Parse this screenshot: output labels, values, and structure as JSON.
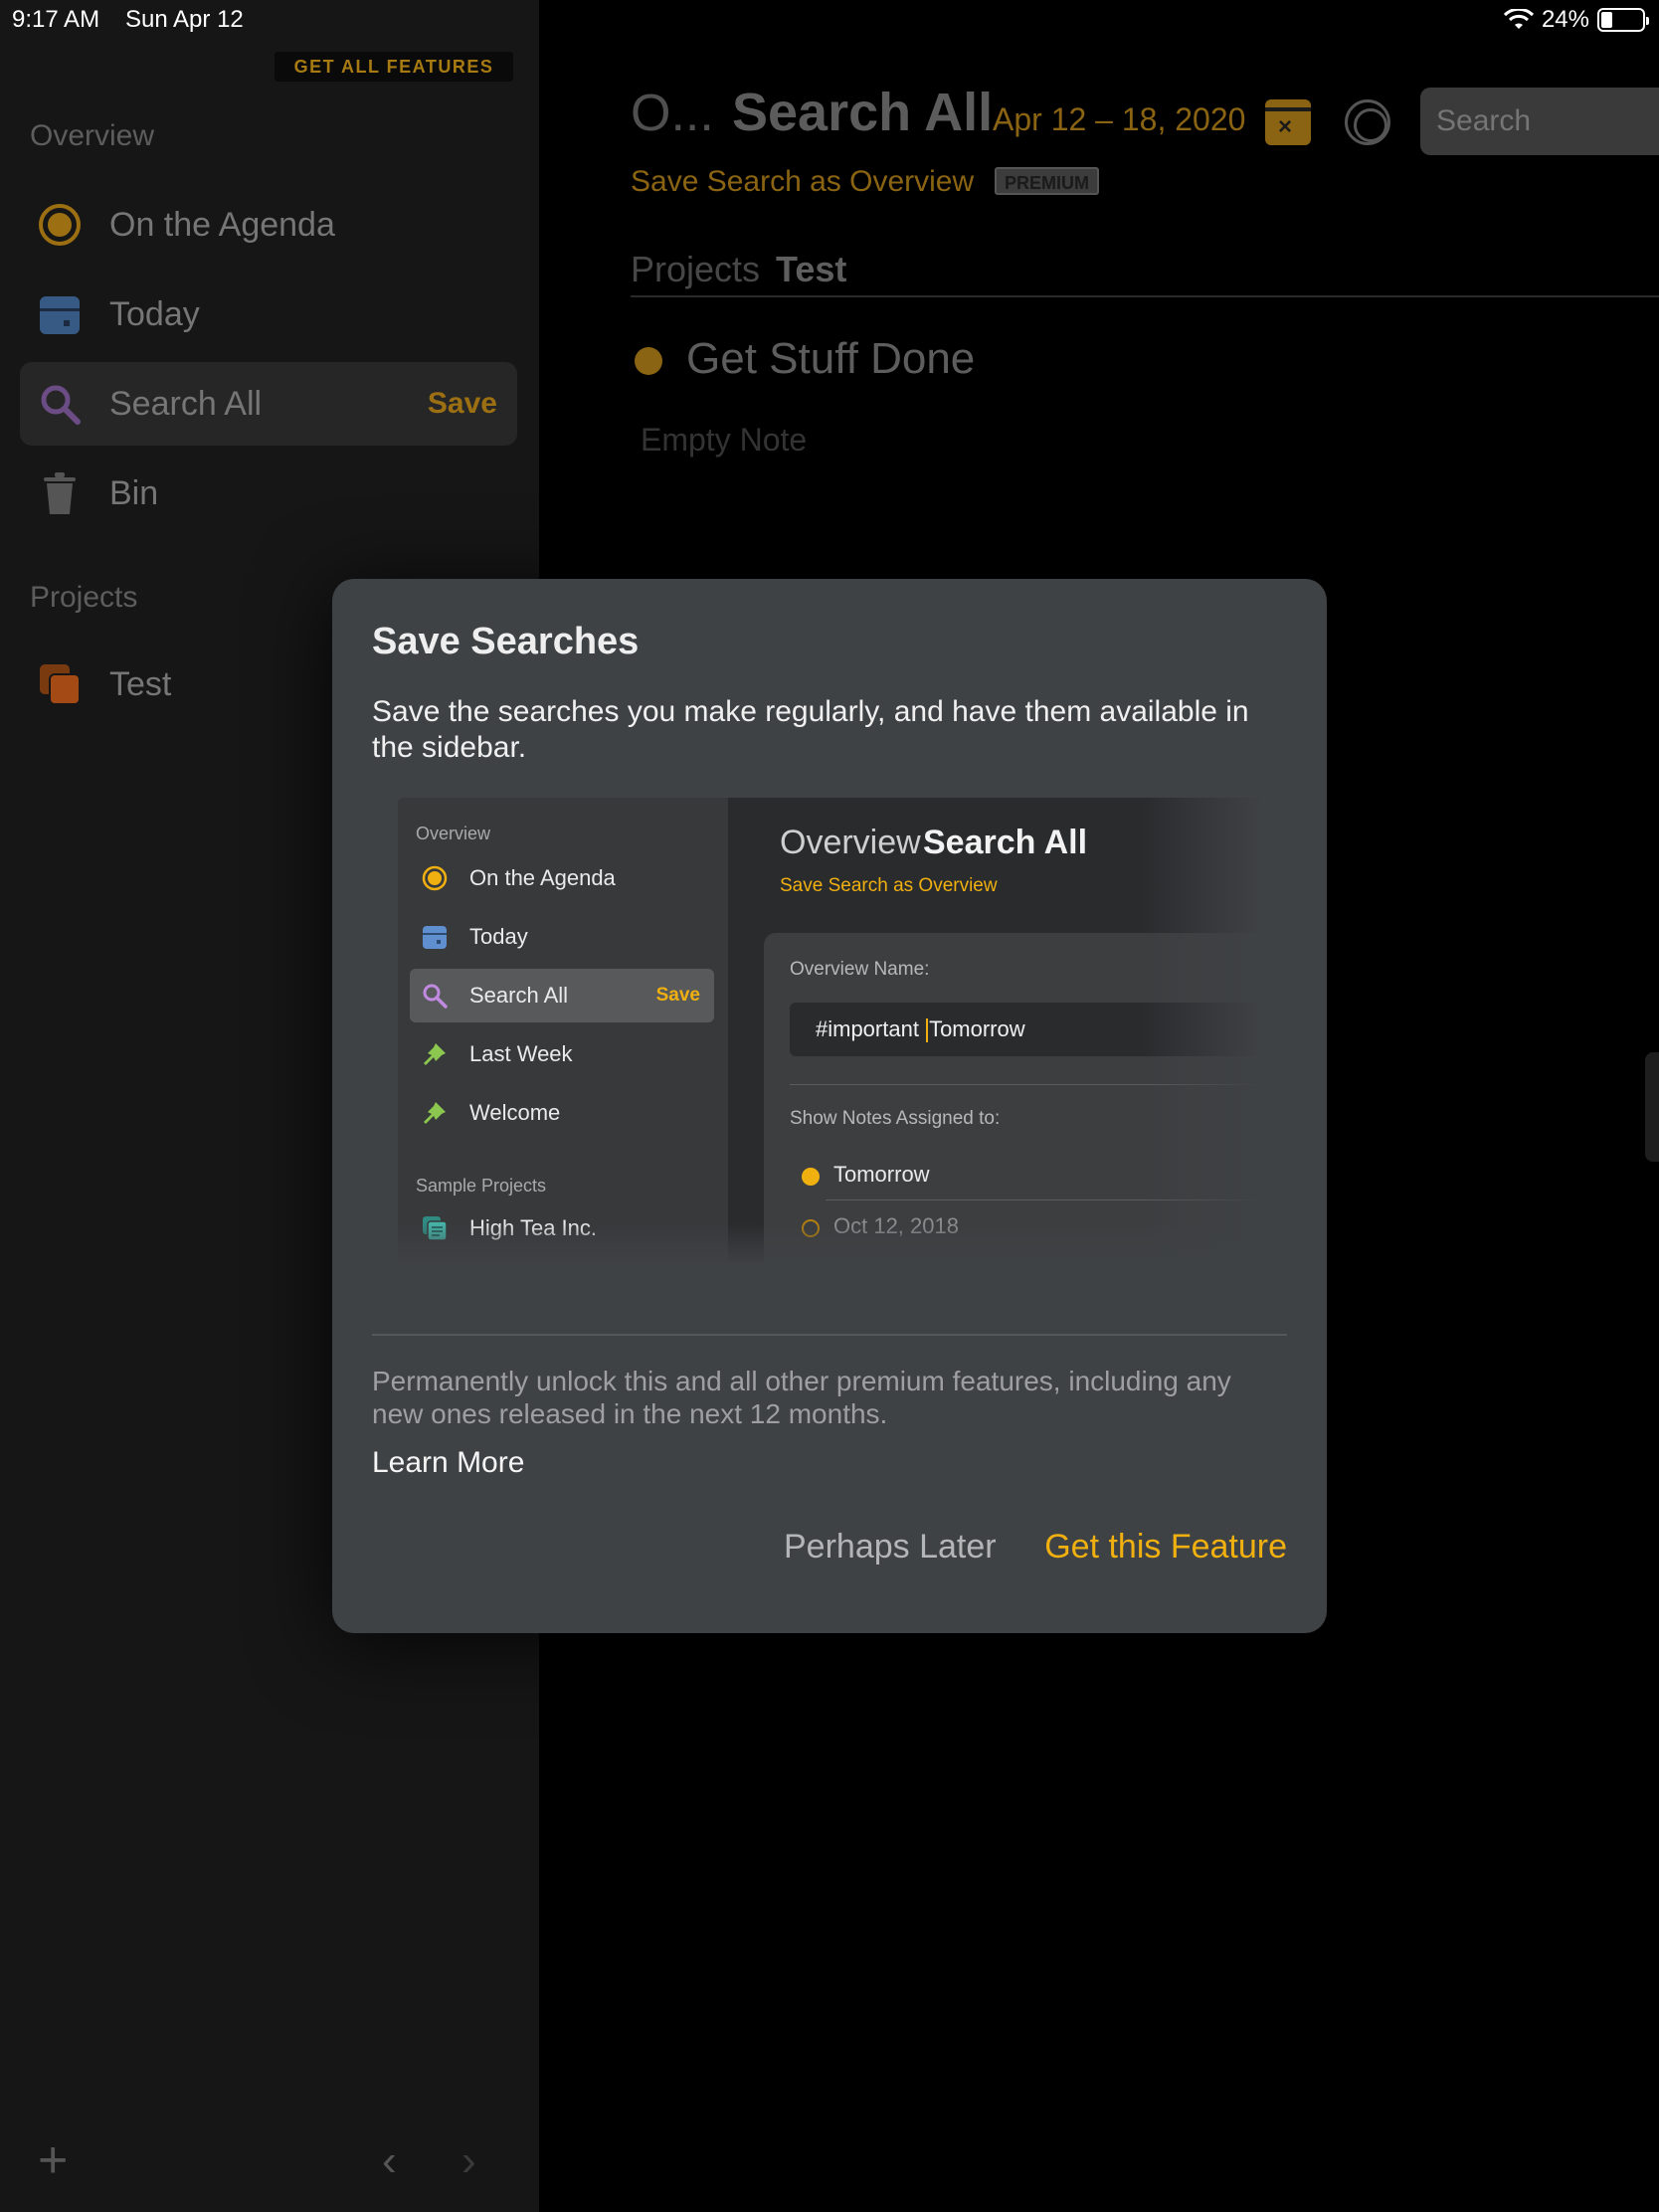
{
  "status_bar": {
    "time": "9:17 AM",
    "date": "Sun Apr 12",
    "battery": "24%",
    "battery_level": 0.24,
    "icons": [
      "wifi-icon",
      "battery-icon"
    ]
  },
  "sidebar": {
    "get_all_features": "GET ALL FEATURES",
    "overview_section": "Overview",
    "items": [
      {
        "label": "On the Agenda",
        "icon": "agenda-icon"
      },
      {
        "label": "Today",
        "icon": "calendar-icon"
      },
      {
        "label": "Search All",
        "icon": "search-icon",
        "action": "Save",
        "selected": true
      },
      {
        "label": "Bin",
        "icon": "trash-icon"
      }
    ],
    "projects_section": "Projects",
    "projects": [
      {
        "label": "Test",
        "icon": "project-stack-icon"
      }
    ],
    "bottom": {
      "add": "+",
      "back": "‹",
      "forward": "›"
    }
  },
  "main": {
    "breadcrumb": "O...",
    "title": "Search All",
    "date_range": "Apr 12 – 18, 2020",
    "calendar_button": "×",
    "search_placeholder": "Search",
    "save_search_link": "Save Search as Overview",
    "premium_badge": "PREMIUM",
    "projects_label": "Projects",
    "project_name": "Test",
    "note_title": "Get Stuff Done",
    "note_body": "Empty Note"
  },
  "modal": {
    "title": "Save Searches",
    "description": "Save the searches you make regularly, and have them available in the sidebar.",
    "preview": {
      "sidebar_section": "Overview",
      "items": [
        {
          "label": "On the Agenda",
          "icon": "agenda-icon"
        },
        {
          "label": "Today",
          "icon": "calendar-icon"
        },
        {
          "label": "Search All",
          "icon": "search-icon",
          "action": "Save",
          "selected": true
        },
        {
          "label": "Last Week",
          "icon": "pin-icon"
        },
        {
          "label": "Welcome",
          "icon": "pin-icon"
        }
      ],
      "projects_section": "Sample Projects",
      "projects": [
        {
          "label": "High Tea Inc.",
          "icon": "project-stack-icon"
        }
      ],
      "crumb": "Overview",
      "title": "Search All",
      "link": "Save Search as Overview",
      "name_label": "Overview Name:",
      "name_before_caret": "#important ",
      "name_after_caret": "Tomorrow",
      "assigned_label": "Show Notes Assigned to:",
      "options": [
        "Tomorrow",
        "Oct 12, 2018"
      ]
    },
    "unlock_text": "Permanently unlock this and all other premium features, including any new ones released in the next 12 months.",
    "learn_more": "Learn More",
    "later_button": "Perhaps Later",
    "get_button": "Get this Feature"
  },
  "colors": {
    "accent": "#f0b010",
    "accent_dimmed": "#8a6412",
    "modal_bg": "#3f4245",
    "sidebar_bg": "#161616"
  }
}
